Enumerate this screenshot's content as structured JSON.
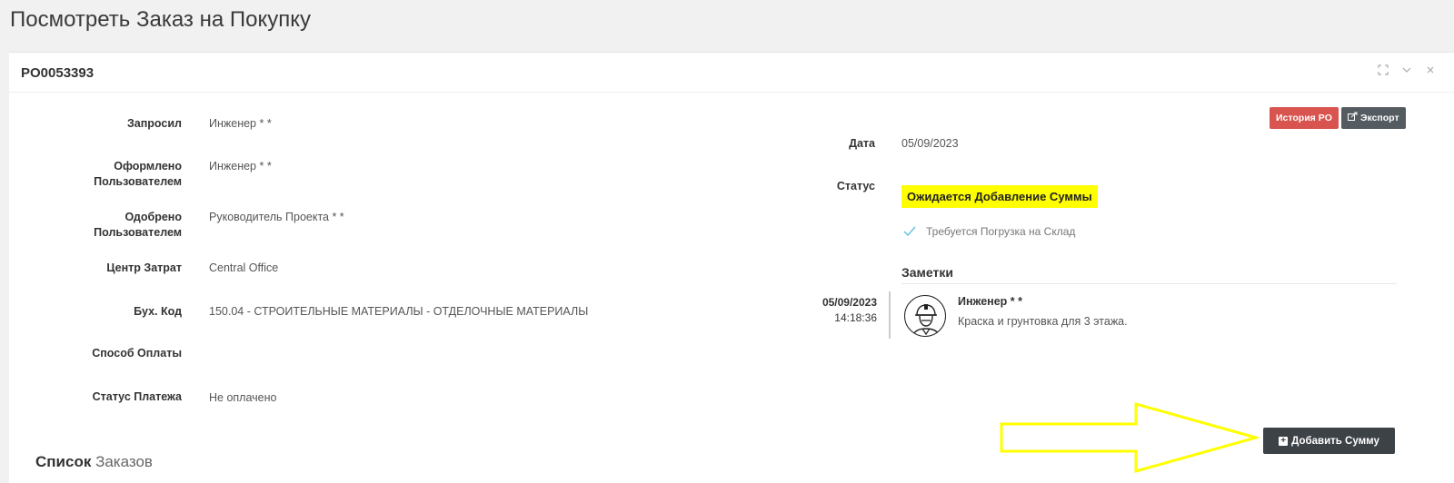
{
  "page": {
    "title": "Посмотреть Заказ на Покупку"
  },
  "panel": {
    "po_number": "PO0053393",
    "tools": [
      "expand-icon",
      "chevron-down-icon",
      "close-icon"
    ]
  },
  "fields": {
    "requested": {
      "label": "Запросил",
      "value": "Инженер * *"
    },
    "issued_by_label_1": "Оформлено",
    "issued_by_label_2": "Пользователем",
    "issued_by_value": "Инженер * *",
    "approved_by_label_1": "Одобрено",
    "approved_by_label_2": "Пользователем",
    "approved_by_value": "Руководитель Проекта * *",
    "cost_center": {
      "label": "Центр Затрат",
      "value": "Central Office"
    },
    "account_code": {
      "label": "Бух. Код",
      "value": "150.04 - СТРОИТЕЛЬНЫЕ МАТЕРИАЛЫ - ОТДЕЛОЧНЫЕ МАТЕРИАЛЫ"
    },
    "payment_method": {
      "label": "Способ Оплаты",
      "value": ""
    },
    "payment_status": {
      "label": "Статус Платежа",
      "value": "Не оплачено"
    }
  },
  "right": {
    "date_label": "Дата",
    "date_value": "05/09/2023",
    "status_label": "Статус",
    "status_value": "Ожидается Добавление Суммы",
    "warehouse_note": "Требуется Погрузка на Склад",
    "history_button": "История PO",
    "export_button": "Экспорт"
  },
  "notes": {
    "title": "Заметки",
    "items": [
      {
        "date": "05/09/2023",
        "time": "14:18:36",
        "author": "Инженер * *",
        "text": "Краска и грунтовка для 3 этажа."
      }
    ]
  },
  "actions": {
    "add_amount": "Добавить Сумму"
  },
  "orders": {
    "heading_bold": "Список",
    "heading_light": "Заказов"
  },
  "colors": {
    "status_highlight": "#ffff00",
    "history_button": "#d9534f",
    "arrow": "#ffff00"
  }
}
